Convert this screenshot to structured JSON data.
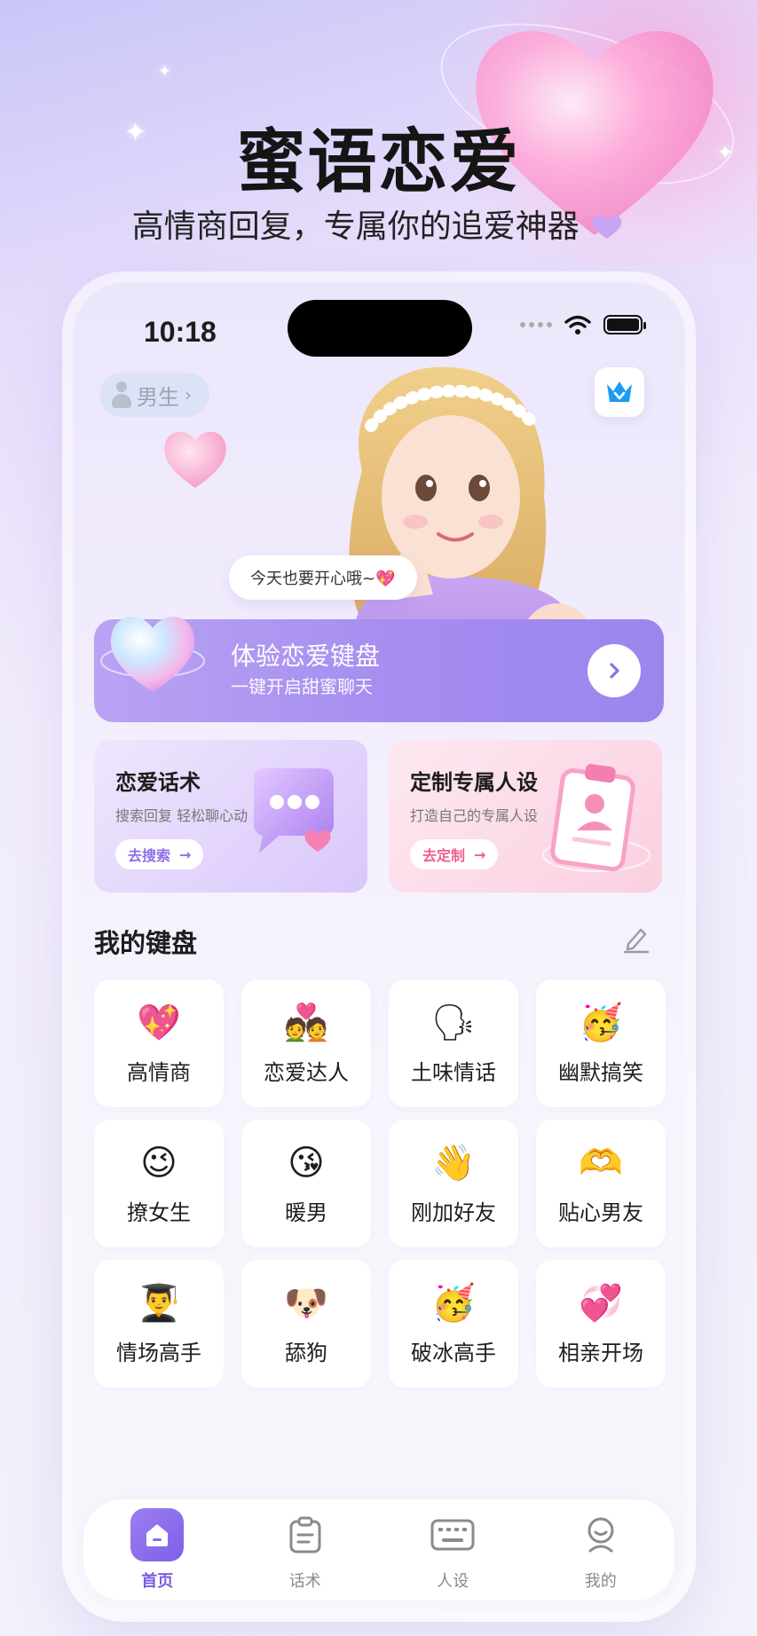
{
  "hero": {
    "title": "蜜语恋爱",
    "subtitle": "高情商回复，专属你的追爱神器"
  },
  "status_bar": {
    "time": "10:18"
  },
  "header": {
    "gender_label": "男生"
  },
  "speech_bubble": "今天也要开心哦~💖",
  "banner": {
    "title": "体验恋爱键盘",
    "subtitle": "一键开启甜蜜聊天"
  },
  "cards": [
    {
      "title": "恋爱话术",
      "subtitle": "搜索回复 轻松聊心动",
      "button": "去搜索"
    },
    {
      "title": "定制专属人设",
      "subtitle": "打造自己的专属人设",
      "button": "去定制"
    }
  ],
  "keyboard_section": {
    "title": "我的键盘",
    "items": [
      {
        "emoji": "💖",
        "label": "高情商"
      },
      {
        "emoji": "💑",
        "label": "恋爱达人"
      },
      {
        "emoji": "🗣",
        "label": "土味情话"
      },
      {
        "emoji": "🥳",
        "label": "幽默搞笑"
      },
      {
        "emoji": "😉",
        "label": "撩女生"
      },
      {
        "emoji": "😘",
        "label": "暖男"
      },
      {
        "emoji": "👋",
        "label": "刚加好友"
      },
      {
        "emoji": "🫶",
        "label": "贴心男友"
      },
      {
        "emoji": "👨‍🎓",
        "label": "情场高手"
      },
      {
        "emoji": "🐶",
        "label": "舔狗"
      },
      {
        "emoji": "🥳",
        "label": "破冰高手"
      },
      {
        "emoji": "💞",
        "label": "相亲开场"
      }
    ]
  },
  "tabbar": {
    "items": [
      {
        "label": "首页",
        "icon": "home-icon",
        "active": true
      },
      {
        "label": "话术",
        "icon": "clipboard-icon",
        "active": false
      },
      {
        "label": "人设",
        "icon": "keyboard-icon",
        "active": false
      },
      {
        "label": "我的",
        "icon": "profile-icon",
        "active": false
      }
    ]
  },
  "colors": {
    "accent": "#8f6ee9",
    "pink_accent": "#ee5e92",
    "banner": "#a58cf0",
    "crown": "#1a9cf0"
  }
}
